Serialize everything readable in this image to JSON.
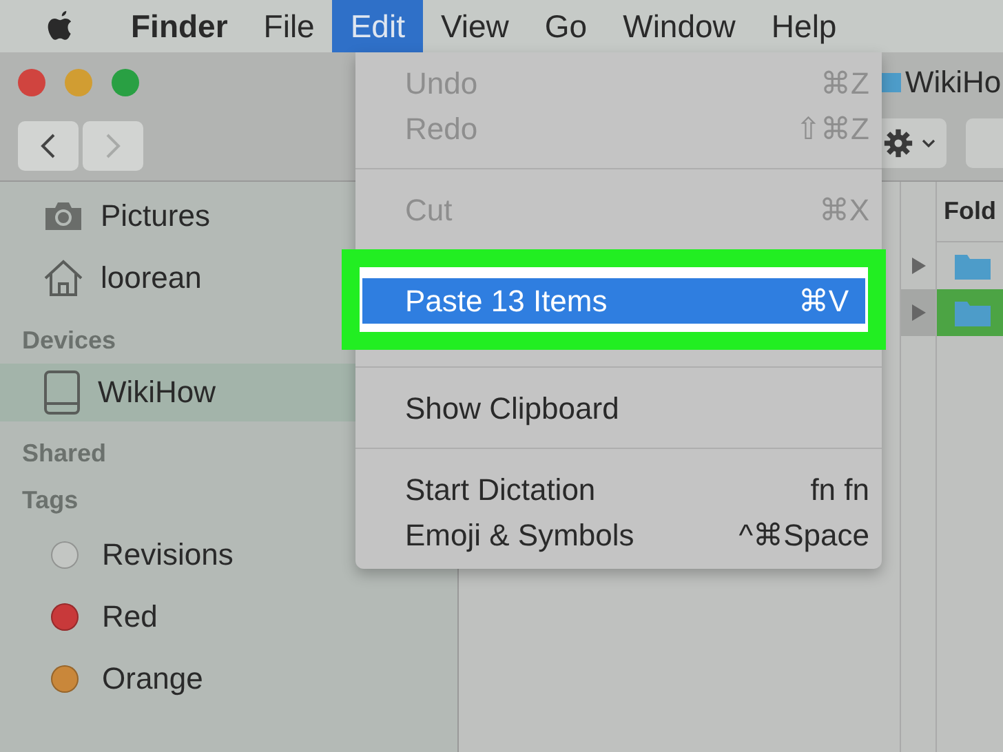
{
  "menubar": {
    "items": [
      {
        "label": "Finder",
        "kind": "app",
        "selected": false
      },
      {
        "label": "File",
        "kind": "menu",
        "selected": false
      },
      {
        "label": "Edit",
        "kind": "menu",
        "selected": true
      },
      {
        "label": "View",
        "kind": "menu",
        "selected": false
      },
      {
        "label": "Go",
        "kind": "menu",
        "selected": false
      },
      {
        "label": "Window",
        "kind": "menu",
        "selected": false
      },
      {
        "label": "Help",
        "kind": "menu",
        "selected": false
      }
    ]
  },
  "window": {
    "title": "WikiHo",
    "nav": [
      {
        "kind": "back",
        "disabled": false
      },
      {
        "kind": "forward",
        "disabled": true
      }
    ]
  },
  "sidebar": {
    "sections": [
      {
        "items": [
          {
            "label": "Pictures",
            "kind": "camera",
            "selected": false
          },
          {
            "label": "loorean",
            "kind": "home",
            "selected": false
          }
        ]
      },
      {
        "heading": "Devices",
        "items": [
          {
            "label": "WikiHow",
            "kind": "drive",
            "selected": true
          }
        ]
      },
      {
        "heading": "Shared"
      },
      {
        "heading": "Tags",
        "items": [
          {
            "label": "Revisions",
            "kind": "tag",
            "color": "#c3c6c3",
            "selected": false
          },
          {
            "label": "Red",
            "kind": "tag",
            "color": "#c8393a",
            "selected": false
          },
          {
            "label": "Orange",
            "kind": "tag",
            "color": "#c9873a",
            "selected": false
          }
        ]
      }
    ]
  },
  "browser": {
    "column_header": "Fold",
    "rows": [
      {
        "selected": false
      },
      {
        "selected": true
      }
    ]
  },
  "edit_menu": {
    "items": [
      {
        "kind": "item",
        "label": "Undo",
        "shortcut": "⌘Z",
        "disabled": true,
        "selected": false
      },
      {
        "kind": "item",
        "label": "Redo",
        "shortcut": "⇧⌘Z",
        "disabled": true,
        "selected": false
      },
      {
        "kind": "separator"
      },
      {
        "kind": "item",
        "label": "Cut",
        "shortcut": "⌘X",
        "disabled": true,
        "selected": false
      },
      {
        "kind": "item",
        "label": "Paste 13 Items",
        "shortcut": "⌘V",
        "disabled": false,
        "selected": true
      },
      {
        "kind": "separator"
      },
      {
        "kind": "item",
        "label": "Show Clipboard",
        "disabled": false,
        "selected": false
      },
      {
        "kind": "separator"
      },
      {
        "kind": "item",
        "label": "Start Dictation",
        "shortcut": "fn fn",
        "disabled": false,
        "selected": false
      },
      {
        "kind": "item",
        "label": "Emoji & Symbols",
        "shortcut": "^⌘Space",
        "disabled": false,
        "selected": false
      }
    ]
  }
}
